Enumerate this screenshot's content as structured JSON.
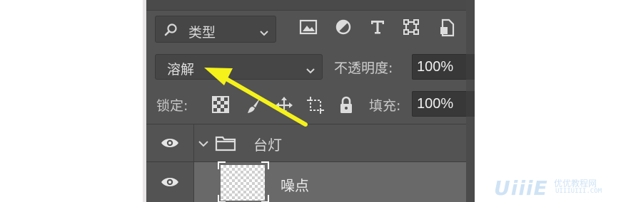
{
  "colors": {
    "panel_bg": "#535353",
    "field_bg": "#464646",
    "highlight_row": "#696969",
    "annotation_arrow": "#f5f21b",
    "watermark": "#cfe3f5"
  },
  "filter": {
    "kind_label": "类型",
    "icons": [
      "image-filter-icon",
      "adjustment-filter-icon",
      "text-filter-icon",
      "shape-filter-icon",
      "smart-object-filter-icon"
    ]
  },
  "blend": {
    "mode": "溶解",
    "opacity_label": "不透明度:",
    "opacity_value": "100%"
  },
  "lock": {
    "label": "锁定:",
    "icons": [
      "lock-transparent-pixels-icon",
      "lock-image-pixels-icon",
      "lock-position-icon",
      "lock-artboard-icon",
      "lock-all-icon"
    ],
    "fill_label": "填充:",
    "fill_value": "100%"
  },
  "layers": [
    {
      "name": "台灯",
      "type": "group",
      "expanded": true,
      "visible": true
    },
    {
      "name": "噪点",
      "type": "layer",
      "visible": true,
      "selected": true
    }
  ],
  "watermark": {
    "logo": "UiiiE",
    "cn": "优优教程网",
    "url": "UIIIUIII.COM"
  }
}
